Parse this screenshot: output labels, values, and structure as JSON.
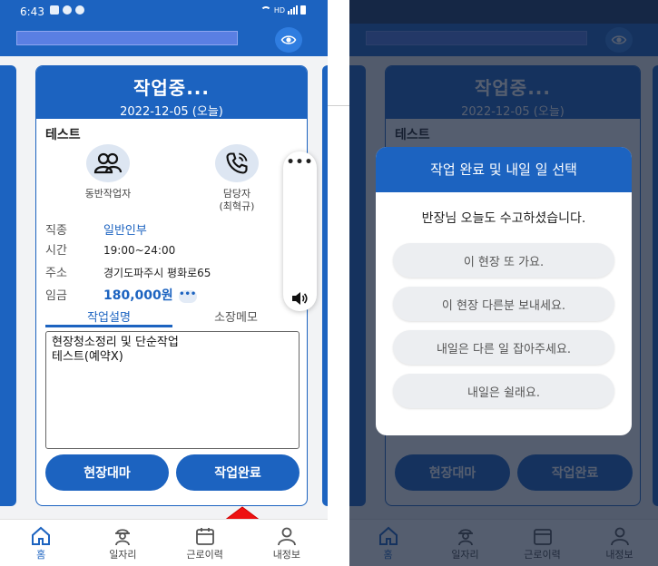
{
  "status_bar": {
    "time": "6:43",
    "network": "HD"
  },
  "card": {
    "status": "작업중...",
    "date": "2022-12-05 (오늘)",
    "job_name": "테스트",
    "contacts": [
      {
        "label": "동반작업자",
        "sub": ""
      },
      {
        "label": "담당자",
        "sub": "(최혁규)"
      }
    ],
    "fields": {
      "category_key": "직종",
      "category_val": "일반인부",
      "time_key": "시간",
      "time_val": "19:00~24:00",
      "address_key": "주소",
      "address_val": "경기도파주시 평화로65",
      "wage_key": "임금",
      "wage_val": "180,000원"
    },
    "tabs": [
      "작업설명",
      "소장메모"
    ],
    "memo": "현장청소정리 및 단순작업\n테스트(예약X)",
    "buttons": {
      "absent": "현장대마",
      "complete": "작업완료"
    }
  },
  "float_panel": {
    "more": "•••"
  },
  "bottom_nav": [
    {
      "label": "홈",
      "icon": "home-icon"
    },
    {
      "label": "일자리",
      "icon": "worker-icon"
    },
    {
      "label": "근로이력",
      "icon": "calendar-icon"
    },
    {
      "label": "내정보",
      "icon": "person-icon"
    }
  ],
  "modal": {
    "title": "작업 완료 및 내일 일 선택",
    "message": "반장님 오늘도 수고하셨습니다.",
    "options": [
      "이 현장 또 가요.",
      "이 현장 다른분 보내세요.",
      "내일은 다른 일 잡아주세요.",
      "내일은 쉴래요."
    ]
  },
  "colors": {
    "primary": "#1c63c0",
    "accent_arrow": "#ee1111"
  }
}
